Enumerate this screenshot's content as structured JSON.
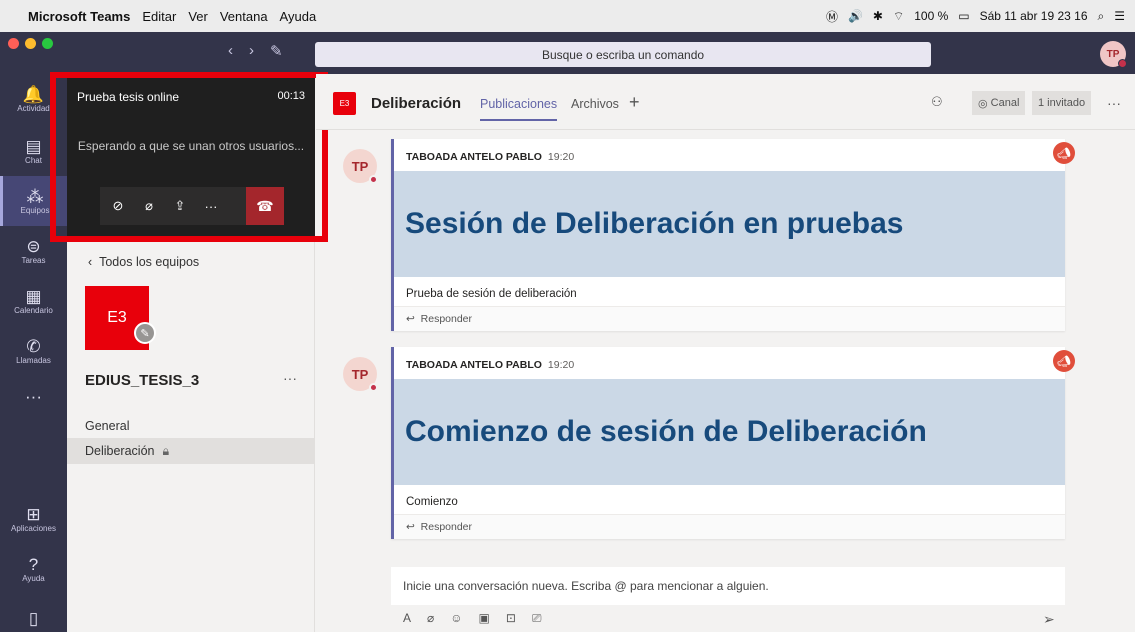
{
  "menubar": {
    "app": "Microsoft Teams",
    "items": [
      "Editar",
      "Ver",
      "Ventana",
      "Ayuda"
    ],
    "battery": "100 %",
    "datetime": "Sáb 11 abr 19 23 16"
  },
  "search": {
    "placeholder": "Busque o escriba un comando"
  },
  "user": {
    "initials": "TP"
  },
  "rail": [
    {
      "label": "Actividad",
      "icon": "bell-icon"
    },
    {
      "label": "Chat",
      "icon": "chat-icon"
    },
    {
      "label": "Equipos",
      "icon": "teams-icon"
    },
    {
      "label": "Tareas",
      "icon": "tasks-icon"
    },
    {
      "label": "Calendario",
      "icon": "calendar-icon"
    },
    {
      "label": "Llamadas",
      "icon": "phone-icon"
    },
    {
      "label": "Aplicaciones",
      "icon": "apps-icon"
    },
    {
      "label": "Ayuda",
      "icon": "help-icon"
    }
  ],
  "call": {
    "title": "Prueba tesis online",
    "duration": "00:13",
    "waiting": "Esperando a que se unan otros usuarios..."
  },
  "teams_nav": {
    "back": "Todos los equipos",
    "team_initials": "E3",
    "team_name": "EDIUS_TESIS_3",
    "channels": [
      "General",
      "Deliberación"
    ]
  },
  "channel": {
    "badge": "E3",
    "title": "Deliberación",
    "tabs": [
      "Publicaciones",
      "Archivos"
    ],
    "canal": "Canal",
    "invited": "1 invitado"
  },
  "posts": [
    {
      "initials": "TP",
      "author": "TABOADA ANTELO PABLO",
      "time": "19:20",
      "banner": "Sesión de Deliberación en pruebas",
      "subject": "Prueba de sesión de deliberación",
      "reply": "Responder"
    },
    {
      "initials": "TP",
      "author": "TABOADA ANTELO PABLO",
      "time": "19:20",
      "banner": "Comienzo de sesión de Deliberación",
      "subject": "Comienzo",
      "reply": "Responder"
    }
  ],
  "compose": {
    "placeholder": "Inicie una conversación nueva. Escriba @ para mencionar a alguien."
  },
  "colors": {
    "accent": "#6264a7",
    "team_red": "#e8000b",
    "dark": "#33344a",
    "highlight_border": "#e8000b"
  }
}
